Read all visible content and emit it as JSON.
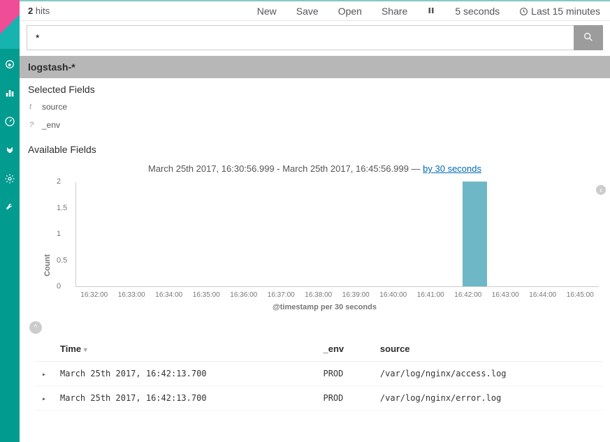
{
  "hits_count": "2",
  "hits_label": "hits",
  "top_actions": {
    "new": "New",
    "save": "Save",
    "open": "Open",
    "share": "Share",
    "refresh_interval": "5 seconds",
    "time_range": "Last 15 minutes"
  },
  "search": {
    "value": "*"
  },
  "index_pattern": "logstash-*",
  "fields": {
    "selected_header": "Selected Fields",
    "available_header": "Available Fields",
    "selected": [
      {
        "type": "t",
        "name": "source"
      },
      {
        "type": "?",
        "name": "_env"
      }
    ]
  },
  "chart_header": {
    "range": "March 25th 2017, 16:30:56.999 - March 25th 2017, 16:45:56.999 — ",
    "interval": "by 30 seconds"
  },
  "chart_data": {
    "type": "bar",
    "ylabel": "Count",
    "xlabel": "@timestamp per 30 seconds",
    "ylim": [
      0,
      2
    ],
    "yticks": [
      0,
      0.5,
      1,
      1.5,
      2
    ],
    "xticks": [
      "16:32:00",
      "16:33:00",
      "16:34:00",
      "16:35:00",
      "16:36:00",
      "16:37:00",
      "16:38:00",
      "16:39:00",
      "16:40:00",
      "16:41:00",
      "16:42:00",
      "16:43:00",
      "16:44:00",
      "16:45:00"
    ],
    "bars": [
      {
        "x_label": "16:42:00",
        "value": 2
      }
    ]
  },
  "table": {
    "headers": {
      "time": "Time",
      "env": "_env",
      "source": "source"
    },
    "rows": [
      {
        "time": "March 25th 2017, 16:42:13.700",
        "env": "PROD",
        "source": "/var/log/nginx/access.log"
      },
      {
        "time": "March 25th 2017, 16:42:13.700",
        "env": "PROD",
        "source": "/var/log/nginx/error.log"
      }
    ]
  }
}
